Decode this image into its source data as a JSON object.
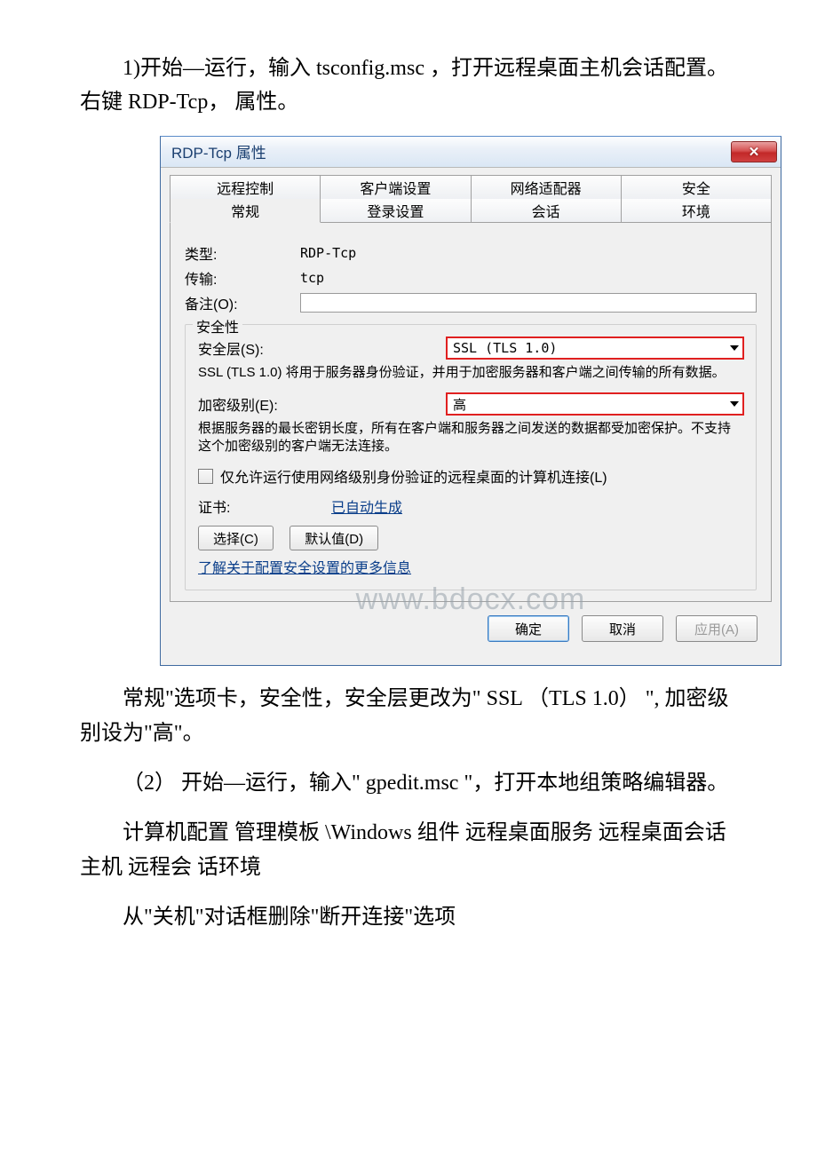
{
  "paragraphs": {
    "p1": "1)开始—运行，输入 tsconfig.msc ，打开远程桌面主机会话配置。右键 RDP-Tcp， 属性。",
    "p2": "常规\"选项卡，安全性，安全层更改为\" SSL （TLS 1.0） \", 加密级别设为\"高\"。",
    "p3": "（2） 开始—运行，输入\" gpedit.msc \"，打开本地组策略编辑器。",
    "p4": "计算机配置 管理模板 \\Windows 组件 远程桌面服务 远程桌面会话主机 远程会 话环境",
    "p5": "从\"关机\"对话框删除\"断开连接\"选项"
  },
  "dialog": {
    "title": "RDP-Tcp 属性",
    "tabs": {
      "back": [
        "远程控制",
        "客户端设置",
        "网络适配器",
        "安全"
      ],
      "front": [
        "常规",
        "登录设置",
        "会话",
        "环境"
      ]
    },
    "general": {
      "type_label": "类型:",
      "type_value": "RDP-Tcp",
      "transport_label": "传输:",
      "transport_value": "tcp",
      "comment_label": "备注(O):",
      "comment_value": ""
    },
    "security": {
      "group_title": "安全性",
      "layer_label": "安全层(S):",
      "layer_value": "SSL (TLS 1.0)",
      "layer_desc": "SSL (TLS 1.0) 将用于服务器身份验证，并用于加密服务器和客户端之间传输的所有数据。",
      "enc_label": "加密级别(E):",
      "enc_value": "高",
      "enc_desc": "根据服务器的最长密钥长度，所有在客户端和服务器之间发送的数据都受加密保护。不支持这个加密级别的客户端无法连接。",
      "nla_checkbox": "仅允许运行使用网络级别身份验证的远程桌面的计算机连接(L)",
      "cert_label": "证书:",
      "cert_value": "已自动生成",
      "select_btn": "选择(C)",
      "default_btn": "默认值(D)",
      "more_link": "了解关于配置安全设置的更多信息"
    },
    "footer": {
      "ok": "确定",
      "cancel": "取消",
      "apply": "应用(A)"
    },
    "watermark": "www.bdocx.com"
  }
}
